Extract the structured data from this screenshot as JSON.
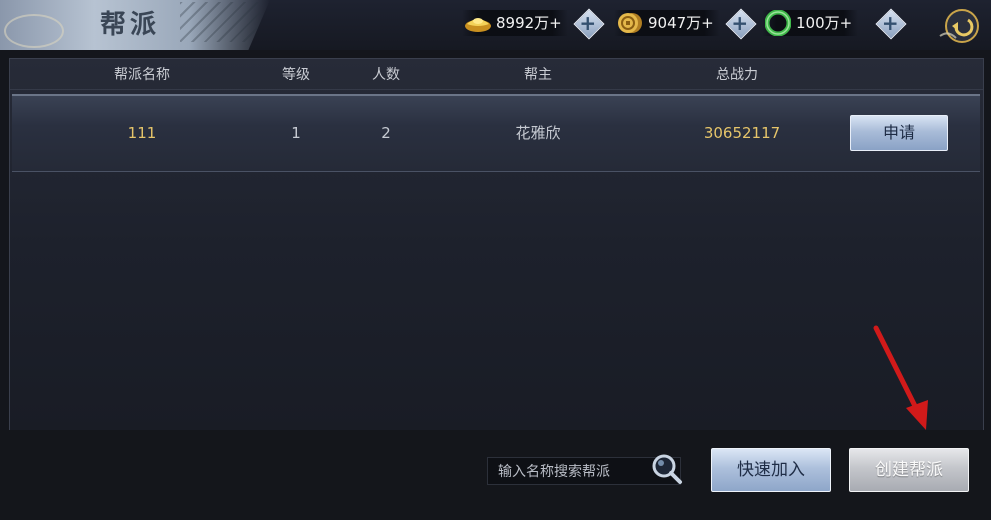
{
  "header": {
    "title": "帮派"
  },
  "currencies": [
    {
      "icon": "gold-ingot-icon",
      "value": "8992万+",
      "color": "#e0b83a"
    },
    {
      "icon": "coin-icon",
      "value": "9047万+",
      "color": "#d6a640"
    },
    {
      "icon": "jade-icon",
      "value": "100万+",
      "color": "#3fb84a"
    }
  ],
  "table": {
    "columns": [
      "帮派名称",
      "等级",
      "人数",
      "帮主",
      "总战力"
    ],
    "rows": [
      {
        "name": "111",
        "level": "1",
        "members": "2",
        "leader": "花雅欣",
        "power": "30652117",
        "action": "申请"
      }
    ]
  },
  "search": {
    "placeholder": "输入名称搜索帮派"
  },
  "buttons": {
    "quick_join": "快速加入",
    "create": "创建帮派"
  },
  "colors": {
    "gold_text": "#e6c56a",
    "annotation_arrow": "#d11a1a"
  }
}
